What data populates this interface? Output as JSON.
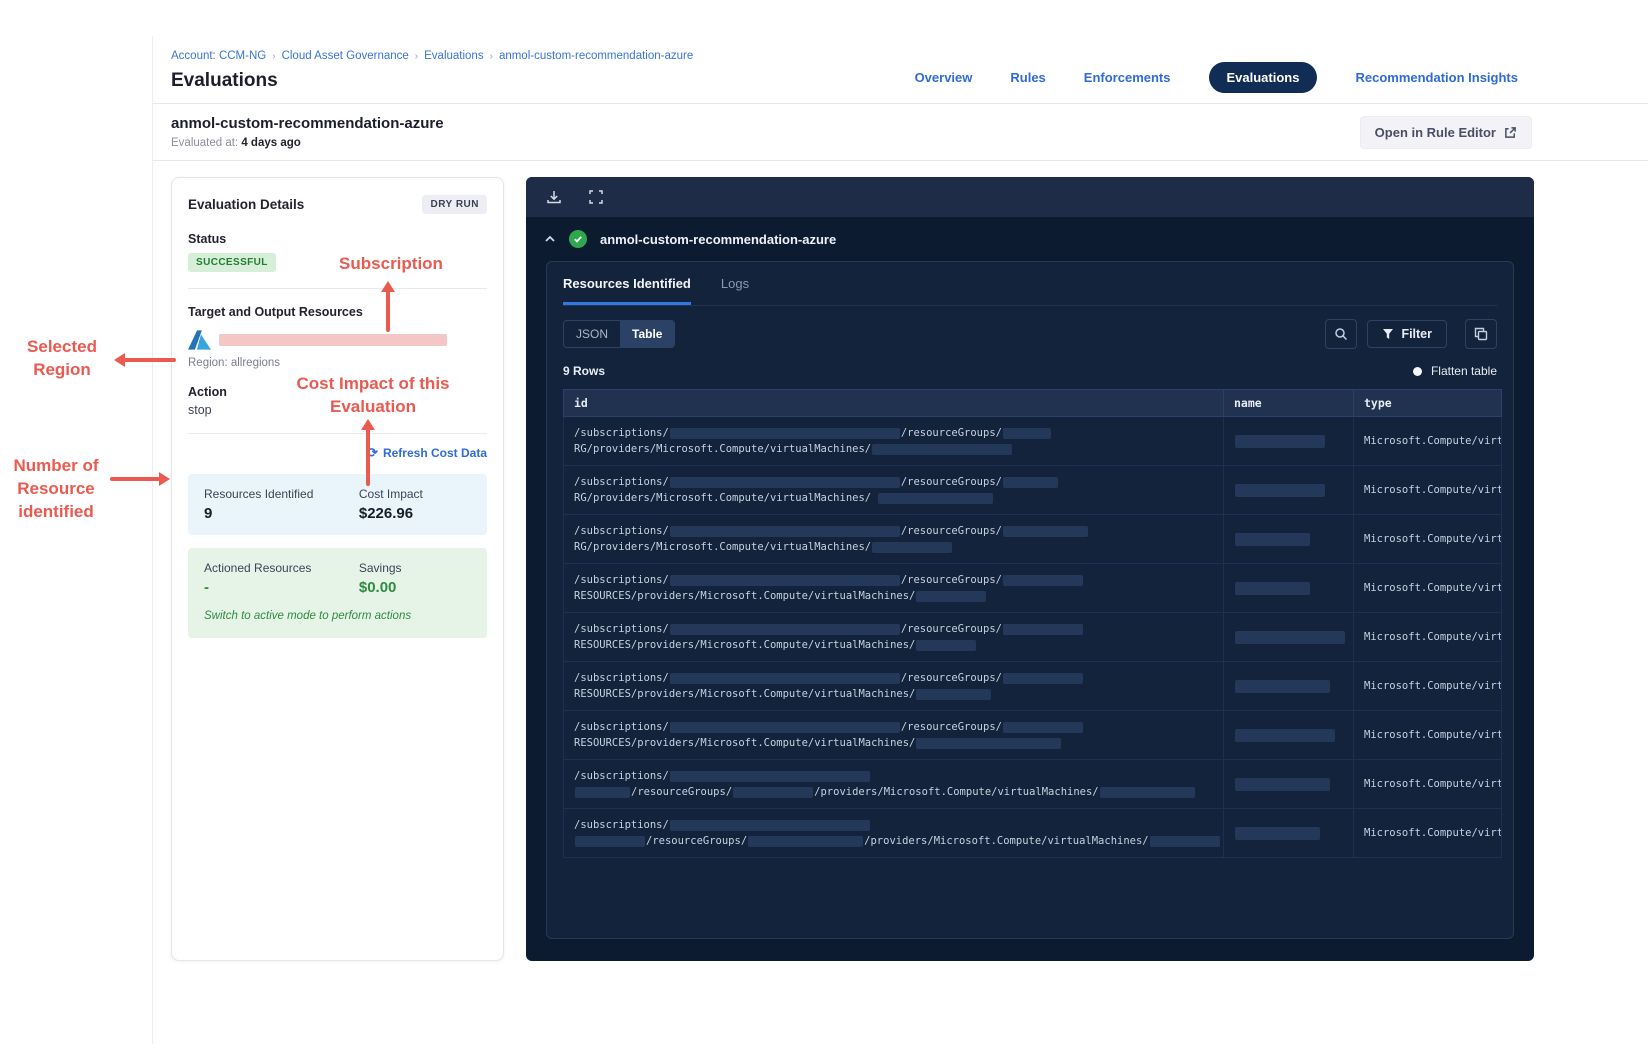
{
  "breadcrumb": {
    "separator": "›",
    "items": [
      "Account: CCM-NG",
      "Cloud Asset Governance",
      "Evaluations",
      "anmol-custom-recommendation-azure"
    ]
  },
  "page_title": "Evaluations",
  "nav": {
    "tabs": [
      {
        "label": "Overview",
        "active": false
      },
      {
        "label": "Rules",
        "active": false
      },
      {
        "label": "Enforcements",
        "active": false
      },
      {
        "label": "Evaluations",
        "active": true
      },
      {
        "label": "Recommendation Insights",
        "active": false
      }
    ]
  },
  "subheader": {
    "title": "anmol-custom-recommendation-azure",
    "evaluated_label": "Evaluated at:",
    "evaluated_value": "4 days ago",
    "open_rule_editor_label": "Open in Rule Editor"
  },
  "details": {
    "title": "Evaluation Details",
    "mode_badge": "DRY RUN",
    "status_label": "Status",
    "status_value": "SUCCESSFUL",
    "target_label": "Target and Output Resources",
    "region": "Region: allregions",
    "action_label": "Action",
    "action_value": "stop",
    "refresh_link": "Refresh Cost Data",
    "stats": {
      "resources_label": "Resources Identified",
      "resources_value": "9",
      "cost_label": "Cost Impact",
      "cost_value": "$226.96",
      "actioned_label": "Actioned Resources",
      "actioned_value": "-",
      "savings_label": "Savings",
      "savings_value": "$0.00",
      "note": "Switch to active mode to perform actions"
    }
  },
  "results": {
    "title": "anmol-custom-recommendation-azure",
    "tabs": [
      "Resources Identified",
      "Logs"
    ],
    "view_toggle": [
      "JSON",
      "Table"
    ],
    "filter_label": "Filter",
    "rows_count": "9 Rows",
    "flatten_label": "Flatten table",
    "table": {
      "columns": [
        "id",
        "name",
        "type"
      ],
      "rows": [
        {
          "id": [
            {
              "t": "/subscriptions/"
            },
            {
              "r": 230
            },
            {
              "t": "/resourceGroups/"
            },
            {
              "r": 48
            },
            {
              "br": true
            },
            {
              "t": "RG/providers/Microsoft.Compute/virtualMachines/"
            },
            {
              "r": 140
            }
          ],
          "name_w": 90,
          "type": "Microsoft.Compute/virtu"
        },
        {
          "id": [
            {
              "t": "/subscriptions/"
            },
            {
              "r": 230
            },
            {
              "t": "/resourceGroups/"
            },
            {
              "r": 55
            },
            {
              "br": true
            },
            {
              "t": "RG/providers/Microsoft.Compute/virtualMachines/ "
            },
            {
              "r": 115
            }
          ],
          "name_w": 90,
          "type": "Microsoft.Compute/virtu"
        },
        {
          "id": [
            {
              "t": "/subscriptions/"
            },
            {
              "r": 230
            },
            {
              "t": "/resourceGroups/"
            },
            {
              "r": 85
            },
            {
              "br": true
            },
            {
              "t": "RG/providers/Microsoft.Compute/virtualMachines/"
            },
            {
              "r": 80
            }
          ],
          "name_w": 75,
          "type": "Microsoft.Compute/virtu"
        },
        {
          "id": [
            {
              "t": "/subscriptions/"
            },
            {
              "r": 230
            },
            {
              "t": "/resourceGroups/"
            },
            {
              "r": 80
            },
            {
              "br": true
            },
            {
              "t": "RESOURCES/providers/Microsoft.Compute/virtualMachines/"
            },
            {
              "r": 70
            }
          ],
          "name_w": 75,
          "type": "Microsoft.Compute/virtu"
        },
        {
          "id": [
            {
              "t": "/subscriptions/"
            },
            {
              "r": 230
            },
            {
              "t": "/resourceGroups/"
            },
            {
              "r": 80
            },
            {
              "br": true
            },
            {
              "t": "RESOURCES/providers/Microsoft.Compute/virtualMachines/"
            },
            {
              "r": 60
            }
          ],
          "name_w": 110,
          "type": "Microsoft.Compute/virtu"
        },
        {
          "id": [
            {
              "t": "/subscriptions/"
            },
            {
              "r": 230
            },
            {
              "t": "/resourceGroups/"
            },
            {
              "r": 80
            },
            {
              "br": true
            },
            {
              "t": "RESOURCES/providers/Microsoft.Compute/virtualMachines/"
            },
            {
              "r": 75
            }
          ],
          "name_w": 95,
          "type": "Microsoft.Compute/virtu"
        },
        {
          "id": [
            {
              "t": "/subscriptions/"
            },
            {
              "r": 230
            },
            {
              "t": "/resourceGroups/"
            },
            {
              "r": 80
            },
            {
              "br": true
            },
            {
              "t": "RESOURCES/providers/Microsoft.Compute/virtualMachines/"
            },
            {
              "r": 145
            }
          ],
          "name_w": 100,
          "type": "Microsoft.Compute/virtu"
        },
        {
          "id": [
            {
              "t": "/subscriptions/"
            },
            {
              "r": 200
            },
            {
              "br": true
            },
            {
              "t": "        "
            },
            {
              "r": 55
            },
            {
              "t": "/resourceGroups/"
            },
            {
              "r": 80
            },
            {
              "t": "/providers/Microsoft.Compute/virtualMachines/"
            },
            {
              "r": 95
            }
          ],
          "name_w": 95,
          "type": "Microsoft.Compute/virtu"
        },
        {
          "id": [
            {
              "t": "/subscriptions/"
            },
            {
              "r": 200
            },
            {
              "br": true
            },
            {
              "t": "        "
            },
            {
              "r": 70
            },
            {
              "t": "/resourceGroups/"
            },
            {
              "r": 115
            },
            {
              "t": "/providers/Microsoft.Compute/virtualMachines/"
            },
            {
              "r": 70
            }
          ],
          "name_w": 85,
          "type": "Microsoft.Compute/virtu"
        }
      ]
    }
  },
  "icons": {
    "refresh": "⟳"
  },
  "annotations": {
    "color": "#ea5a50",
    "subscription": "Subscription",
    "selected_region": "Selected\nRegion",
    "cost_impact": "Cost Impact of this\nEvaluation",
    "resources_identified": "Number of\nResource\nidentified"
  }
}
